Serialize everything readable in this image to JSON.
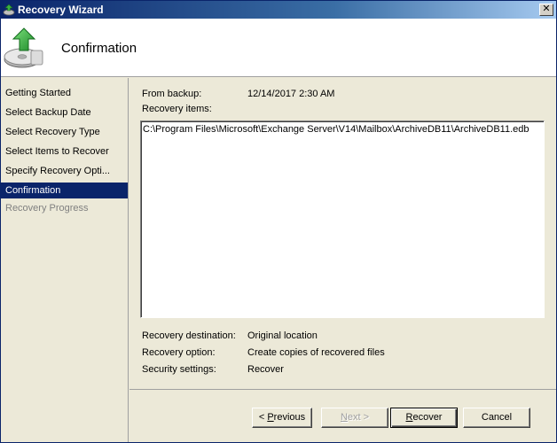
{
  "window": {
    "title": "Recovery Wizard",
    "close_glyph": "✕"
  },
  "header": {
    "title": "Confirmation",
    "icon": "backup-disk-restore-icon"
  },
  "sidebar": {
    "items": [
      {
        "label": "Getting Started",
        "state": "normal"
      },
      {
        "label": "Select Backup Date",
        "state": "normal"
      },
      {
        "label": "Select Recovery Type",
        "state": "normal"
      },
      {
        "label": "Select Items to Recover",
        "state": "normal"
      },
      {
        "label": "Specify Recovery Opti...",
        "state": "normal"
      },
      {
        "label": "Confirmation",
        "state": "active"
      },
      {
        "label": "Recovery Progress",
        "state": "disabled"
      }
    ]
  },
  "details": {
    "from_backup_label": "From backup:",
    "from_backup_value": "12/14/2017 2:30 AM",
    "recovery_items_label": "Recovery items:",
    "recovery_items": [
      "C:\\Program Files\\Microsoft\\Exchange Server\\V14\\Mailbox\\ArchiveDB11\\ArchiveDB11.edb"
    ],
    "destination_label": "Recovery destination:",
    "destination_value": "Original location",
    "option_label": "Recovery option:",
    "option_value": "Create copies of recovered files",
    "security_label": "Security settings:",
    "security_value": "Recover"
  },
  "buttons": {
    "previous": {
      "prefix": "< ",
      "mnemonic": "P",
      "rest": "revious"
    },
    "next": {
      "mnemonic": "N",
      "rest": "ext >"
    },
    "recover": {
      "mnemonic": "R",
      "rest": "ecover"
    },
    "cancel": {
      "label": "Cancel"
    }
  }
}
